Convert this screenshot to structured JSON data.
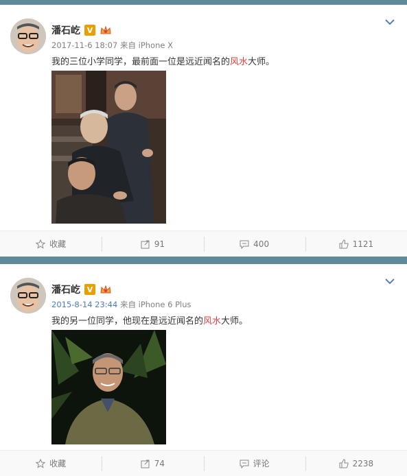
{
  "posts": [
    {
      "author": "潘石屹",
      "verified_badge": "V",
      "time": "2017-11-6 18:07",
      "source_prefix": "来自",
      "source": "iPhone X",
      "text_before": "我的三位小学同学，最前面一位是远近闻名的",
      "text_keyword": "风水",
      "text_after": "大师。",
      "actions": {
        "favorite_label": "收藏",
        "repost_count": "91",
        "comment_count": "400",
        "like_count": "1121"
      }
    },
    {
      "author": "潘石屹",
      "verified_badge": "V",
      "time": "2015-8-14 23:44",
      "source_prefix": "来自",
      "source": "iPhone 6 Plus",
      "text_before": "我的另一位同学，他现在是远近闻名的",
      "text_keyword": "风水",
      "text_after": "大师。",
      "actions": {
        "favorite_label": "收藏",
        "repost_count": "74",
        "comment_count": "评论",
        "like_count": "2238"
      }
    }
  ],
  "icons": {
    "favorite": "star-icon",
    "repost": "repost-icon",
    "comment": "comment-icon",
    "like": "thumbs-up-icon",
    "menu": "chevron-down-icon",
    "crown": "crown-icon"
  },
  "colors": {
    "keyword": "#e83e3e",
    "badge": "#e8a000",
    "time_link": "#4a7ec2",
    "separator": "#5f8a99"
  }
}
